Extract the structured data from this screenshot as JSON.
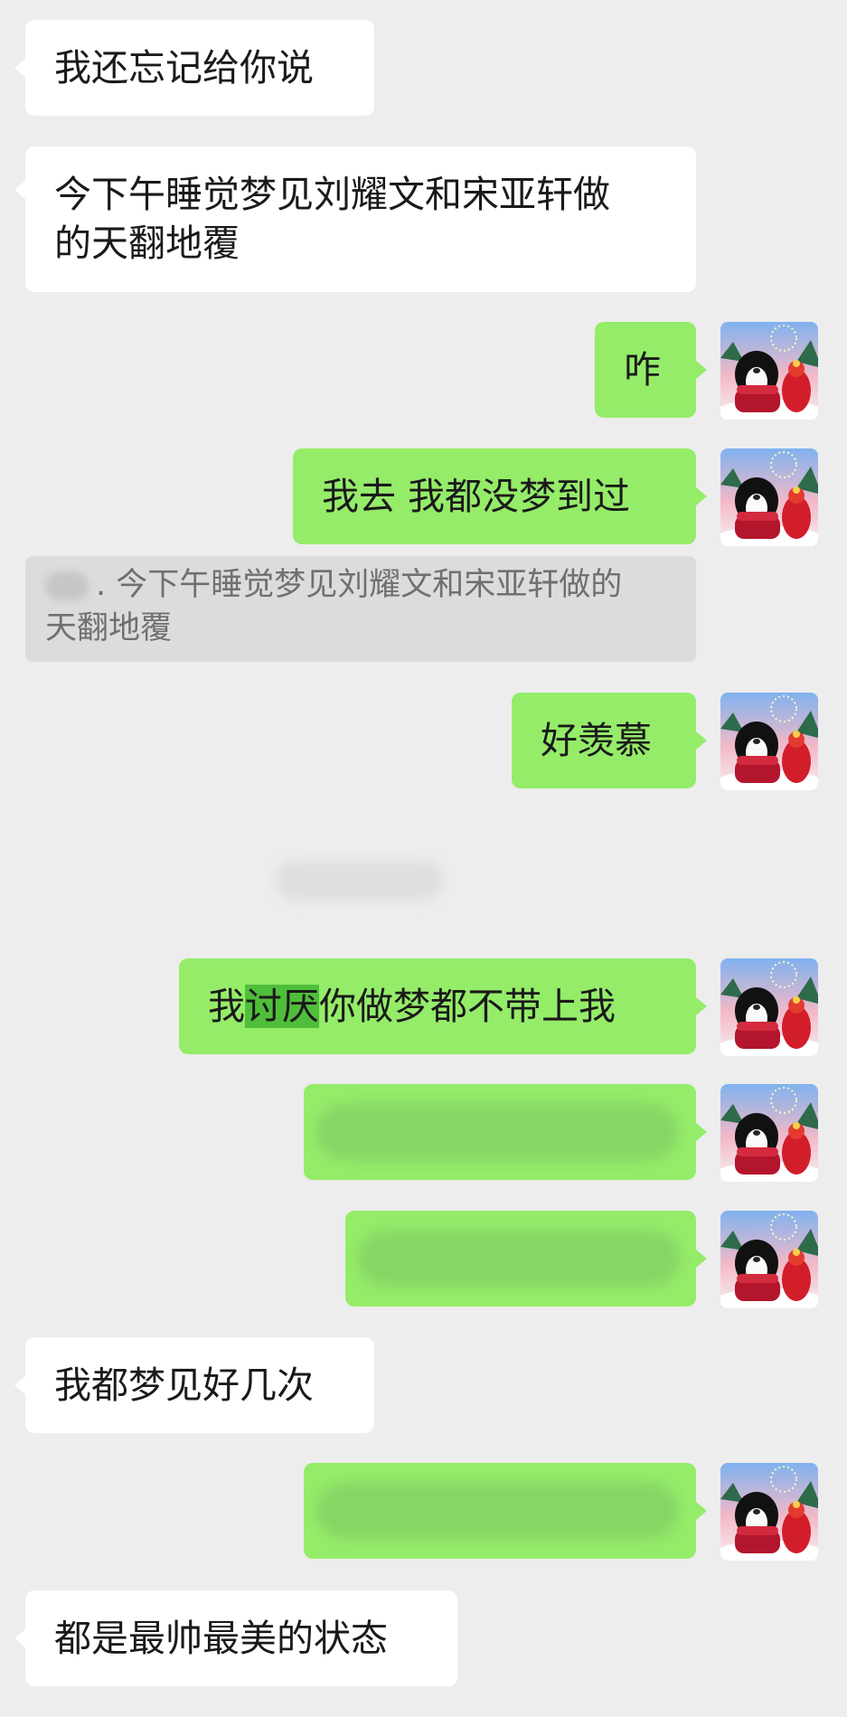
{
  "messages": [
    {
      "side": "left",
      "text": "我还忘记给你说"
    },
    {
      "side": "left",
      "text": "今下午睡觉梦见刘耀文和宋亚轩做的天翻地覆",
      "line1": "今下午睡觉梦见刘耀文和宋亚轩做",
      "line2": "的天翻地覆"
    },
    {
      "side": "right",
      "text": "咋"
    },
    {
      "side": "right",
      "text": "我去 我都没梦到过"
    },
    {
      "side": "right",
      "text": "好羡慕"
    },
    {
      "side": "right",
      "text_before": "我",
      "text_highlight": "讨厌",
      "text_after": "你做梦都不带上我"
    },
    {
      "side": "right",
      "text": ""
    },
    {
      "side": "right",
      "text": ""
    },
    {
      "side": "left",
      "text": "我都梦见好几次"
    },
    {
      "side": "right",
      "text": ""
    },
    {
      "side": "left",
      "text": "都是最帅最美的状态"
    }
  ],
  "quote": {
    "line1": ". 今下午睡觉梦见刘耀文和宋亚轩做的",
    "line2": "天翻地覆"
  },
  "colors": {
    "background": "#ededed",
    "bubble_left": "#ffffff",
    "bubble_right": "#95ec69",
    "highlight": "#4fbe3a",
    "quote_bg": "#dcdcdc"
  },
  "avatar_icon": "dog-in-red-scarf-avatar"
}
